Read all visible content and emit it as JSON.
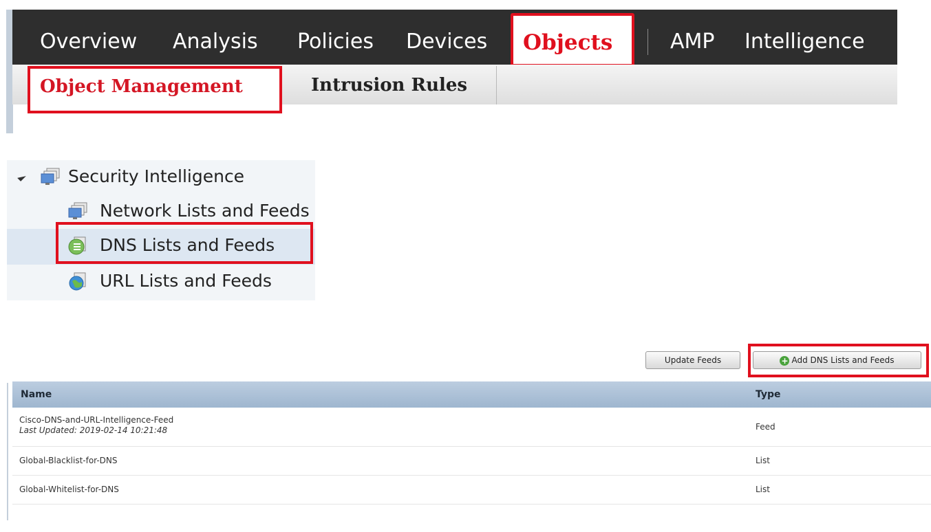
{
  "top_nav": {
    "items": [
      "Overview",
      "Analysis",
      "Policies",
      "Devices",
      "Objects",
      "AMP",
      "Intelligence"
    ],
    "active": "Objects"
  },
  "sub_nav": {
    "tabs": [
      "Object Management",
      "Intrusion Rules"
    ],
    "active": "Object Management"
  },
  "tree": {
    "parent": "Security Intelligence",
    "children": [
      "Network Lists and Feeds",
      "DNS Lists and Feeds",
      "URL Lists and Feeds"
    ],
    "selected": "DNS Lists and Feeds"
  },
  "buttons": {
    "update_feeds": "Update Feeds",
    "add_dns": "Add DNS Lists and Feeds"
  },
  "table": {
    "columns": [
      "Name",
      "Type"
    ],
    "rows": [
      {
        "name": "Cisco-DNS-and-URL-Intelligence-Feed",
        "subtext": "Last Updated: 2019-02-14 10:21:48",
        "type": "Feed"
      },
      {
        "name": "Global-Blacklist-for-DNS",
        "type": "List"
      },
      {
        "name": "Global-Whitelist-for-DNS",
        "type": "List"
      }
    ]
  },
  "colors": {
    "highlight": "#e0101e",
    "nav_bg": "#2e2e2e"
  }
}
